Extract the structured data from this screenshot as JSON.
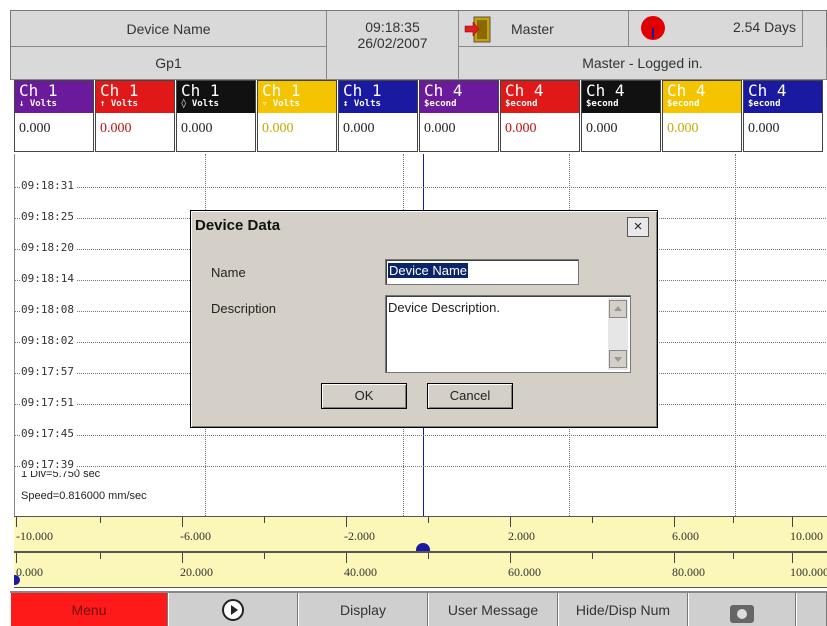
{
  "header": {
    "device_name": "Device Name",
    "group": "Gp1",
    "time": "09:18:35",
    "date": "26/02/2007",
    "user": "Master",
    "days": "2.54 Days",
    "status": "Master - Logged in."
  },
  "channels": [
    {
      "name": "Ch 1",
      "unit": "↓ Volts",
      "value": "0.000",
      "color": "#6a1a9a"
    },
    {
      "name": "Ch 1",
      "unit": "↑ Volts",
      "value": "0.000",
      "color": "#e01818"
    },
    {
      "name": "Ch 1",
      "unit": "◊ Volts",
      "value": "0.000",
      "color": "#111111"
    },
    {
      "name": "Ch 1",
      "unit": "▿ Volts",
      "value": "0.000",
      "color": "#f4c400"
    },
    {
      "name": "Ch 1",
      "unit": "↕ Volts",
      "value": "0.000",
      "color": "#1a1aa0"
    },
    {
      "name": "Ch 4",
      "unit": "$econd",
      "value": "0.000",
      "color": "#6a1a9a"
    },
    {
      "name": "Ch 4",
      "unit": "$econd",
      "value": "0.000",
      "color": "#e01818"
    },
    {
      "name": "Ch 4",
      "unit": "$econd",
      "value": "0.000",
      "color": "#111111"
    },
    {
      "name": "Ch 4",
      "unit": "$econd",
      "value": "0.000",
      "color": "#f4c400"
    },
    {
      "name": "Ch 4",
      "unit": "$econd",
      "value": "0.000",
      "color": "#1a1aa0"
    }
  ],
  "chart": {
    "time_labels": [
      "09:18:31",
      "09:18:25",
      "09:18:20",
      "09:18:14",
      "09:18:08",
      "09:18:02",
      "09:17:57",
      "09:17:51",
      "09:17:45",
      "09:17:39"
    ],
    "div_info": "1 Div=5.750 sec",
    "speed_info": "Speed=0.816000 mm/sec"
  },
  "scale1": [
    "-10.000",
    "-6.000",
    "-2.000",
    "2.000",
    "6.000",
    "10.000"
  ],
  "scale2": [
    "0.000",
    "20.000",
    "40.000",
    "60.000",
    "80.000",
    "100.000"
  ],
  "toolbar": {
    "menu": "Menu",
    "display": "Display",
    "user_message": "User Message",
    "hide_disp_num": "Hide/Disp Num"
  },
  "dialog": {
    "title": "Device Data",
    "close": "×",
    "name_label": "Name",
    "name_value": "Device Name",
    "description_label": "Description",
    "description_value": "Device Description.",
    "ok": "OK",
    "cancel": "Cancel"
  },
  "colors": {
    "menu_button": "#ff1a1a",
    "scale_background": "#fbf7b8",
    "trace": "#1a1aa0"
  },
  "icons": [
    "door-exit-icon",
    "alarm-pie-icon",
    "play-icon",
    "camera-icon",
    "close-icon",
    "scroll-up-icon",
    "scroll-down-icon"
  ]
}
